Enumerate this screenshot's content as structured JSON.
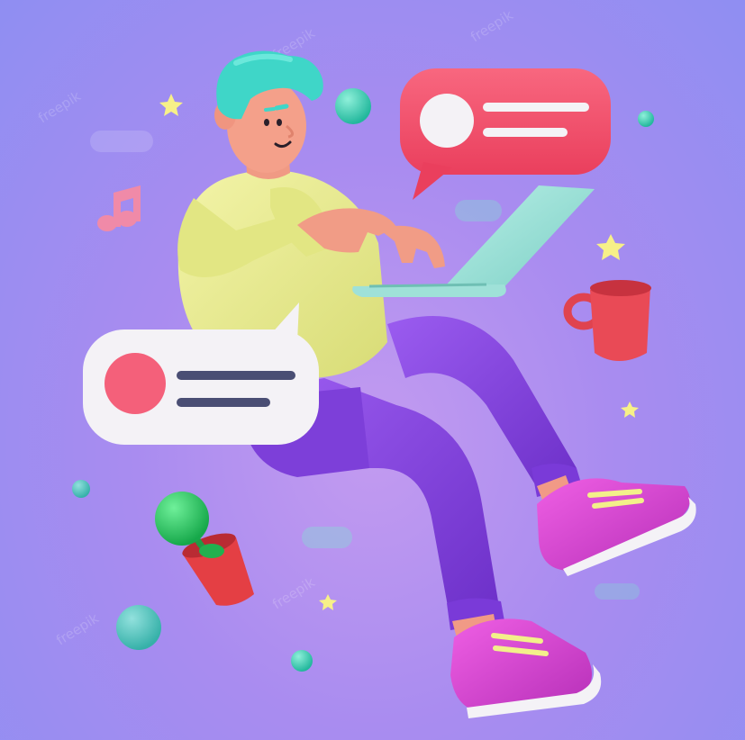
{
  "image": {
    "description_colors": {
      "background_top": "#8f8ef2",
      "background_bottom": "#c39bf0",
      "hair": "#3fd6c8",
      "sweater": "#eaed92",
      "pants": "#8a45e0",
      "shoes": "#d83fd0",
      "laptop": "#9ee0d8",
      "bubble_red": "#f4566f",
      "bubble_white": "#f4f2f6",
      "mug": "#e94a56",
      "plant_pot": "#e43f44",
      "plant_ball": "#2fcf6a",
      "teal_orb": "#39d2b4",
      "star": "#f7f088",
      "music_note": "#f08aa8"
    }
  },
  "watermark": {
    "text": "freepik"
  }
}
